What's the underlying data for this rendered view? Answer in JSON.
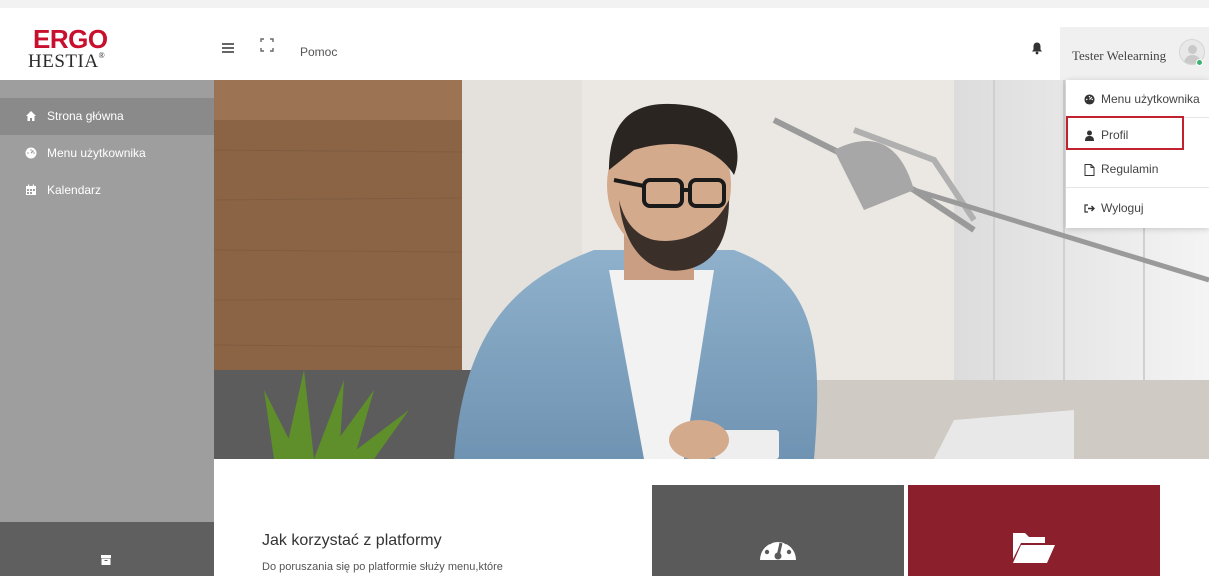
{
  "logo": {
    "line1": "ERGO",
    "line2": "HESTIA",
    "reg": "®"
  },
  "header": {
    "menu_icon": "hamburger-icon",
    "fullscreen_icon": "expand-icon",
    "help_label": "Pomoc",
    "notification_icon": "bell-icon",
    "user_name": "Tester Welearning"
  },
  "sidebar": {
    "items": [
      {
        "label": "Strona główna",
        "icon": "home-icon",
        "active": true
      },
      {
        "label": "Menu użytkownika",
        "icon": "dashboard-icon",
        "active": false
      },
      {
        "label": "Kalendarz",
        "icon": "calendar-icon",
        "active": false
      }
    ],
    "footer_icon": "archive-icon"
  },
  "user_menu": {
    "items": [
      {
        "label": "Menu użytkownika",
        "icon": "dashboard-icon"
      },
      {
        "label": "Profil",
        "icon": "user-icon"
      },
      {
        "label": "Regulamin",
        "icon": "document-icon"
      },
      {
        "label": "Wyloguj",
        "icon": "logout-icon"
      }
    ]
  },
  "main": {
    "section_title": "Jak korzystać z platformy",
    "section_text": "Do poruszania się po platformie służy menu,które",
    "tiles": [
      {
        "icon": "dashboard-icon",
        "color": "#5a5a5a"
      },
      {
        "icon": "folder-open-icon",
        "color": "#8b1f2c"
      }
    ]
  },
  "colors": {
    "brand_red": "#c8102e",
    "sidebar_bg": "#9e9e9e",
    "highlight": "#c0232f"
  }
}
